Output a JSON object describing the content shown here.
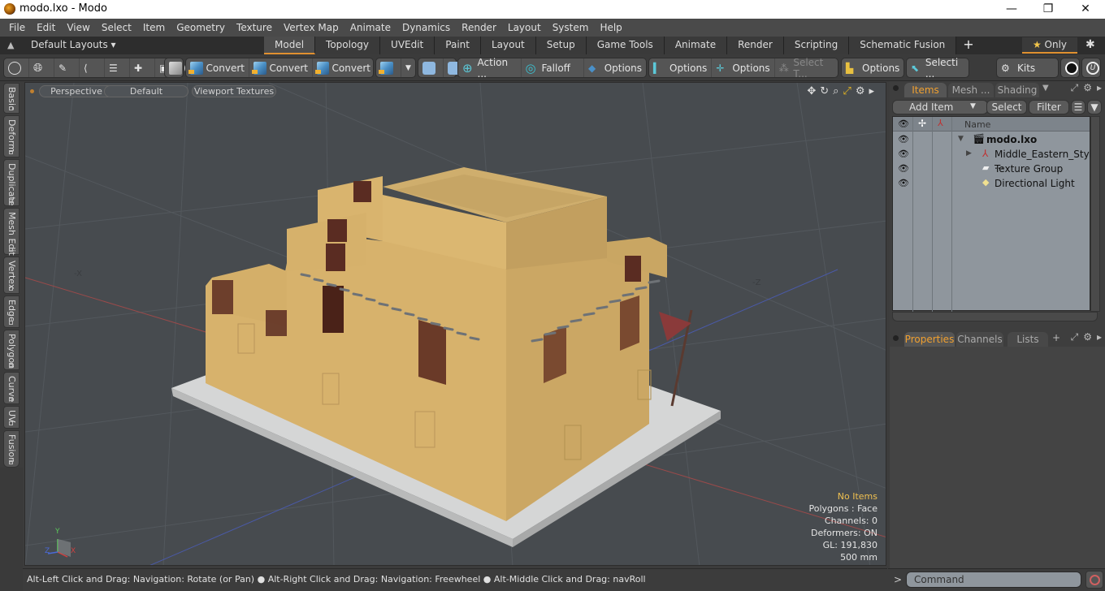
{
  "window": {
    "title": "modo.lxo - Modo",
    "minimize": "—",
    "maximize": "❐",
    "close": "✕"
  },
  "menu": [
    "File",
    "Edit",
    "View",
    "Select",
    "Item",
    "Geometry",
    "Texture",
    "Vertex Map",
    "Animate",
    "Dynamics",
    "Render",
    "Layout",
    "System",
    "Help"
  ],
  "layouts": {
    "dropdown_label": "Default Layouts ▾",
    "tabs": [
      {
        "label": "Model",
        "active": true
      },
      {
        "label": "Topology"
      },
      {
        "label": "UVEdit"
      },
      {
        "label": "Paint"
      },
      {
        "label": "Layout"
      },
      {
        "label": "Setup"
      },
      {
        "label": "Game Tools"
      },
      {
        "label": "Animate"
      },
      {
        "label": "Render"
      },
      {
        "label": "Scripting"
      },
      {
        "label": "Schematic Fusion"
      }
    ],
    "add_tab": "+",
    "only_star": "★",
    "only_label": "Only",
    "gear": "✱"
  },
  "toolbar": {
    "convert1": "Convert",
    "convert2": "Convert",
    "convert3": "Convert",
    "action": "Action  ...",
    "falloff": "Falloff",
    "options1": "Options",
    "options2": "Options",
    "options3": "Options",
    "select_t": "Select T...",
    "options4": "Options",
    "selecti": "Selecti ...",
    "kits": "Kits"
  },
  "left_tabs": [
    "Basic",
    "Deform",
    "Duplicate",
    "Mesh Edit",
    "Vertex",
    "Edge",
    "Polygon",
    "Curve",
    "UV",
    "Fusion"
  ],
  "viewport": {
    "view_label": "Perspective",
    "style_label": "Default",
    "shading_label": "Viewport Textures",
    "axis_neg_x": "-X",
    "axis_neg_z": "-Z",
    "info": {
      "selection": "No Items",
      "polygons": "Polygons : Face",
      "channels": "Channels: 0",
      "deformers": "Deformers: ON",
      "gl": "GL: 191,830",
      "scale": "500 mm"
    },
    "gizmo": {
      "x": "X",
      "y": "Y",
      "z": "Z"
    }
  },
  "status": "Alt-Left Click and Drag: Navigation: Rotate (or Pan) ● Alt-Right Click and Drag: Navigation: Freewheel ● Alt-Middle Click and Drag: navRoll",
  "items_panel": {
    "tabs": [
      {
        "label": "Items",
        "active": true
      },
      {
        "label": "Mesh ..."
      },
      {
        "label": "Shading"
      }
    ],
    "add_item": "Add Item",
    "select": "Select",
    "filter": "Filter",
    "name_header": "Name",
    "tree": [
      {
        "name": "modo.lxo",
        "bold": true,
        "icon": "scene-icon"
      },
      {
        "name": "Middle_Eastern_Styl ...",
        "icon": "mesh-locator-icon"
      },
      {
        "name": "Texture Group",
        "icon": "folder-icon"
      },
      {
        "name": "Directional Light",
        "icon": "light-icon"
      }
    ]
  },
  "props_panel": {
    "tabs": [
      {
        "label": "Properties",
        "active": true
      },
      {
        "label": "Channels"
      },
      {
        "label": "Lists"
      }
    ],
    "add": "+"
  },
  "command": {
    "prompt": ">",
    "placeholder": "Command"
  },
  "colors": {
    "accent": "#e09030",
    "info_highlight": "#f0c050",
    "tree_bg": "#8f969d",
    "viewport_bg": "#474b4f",
    "wall": "#d9b46e"
  }
}
